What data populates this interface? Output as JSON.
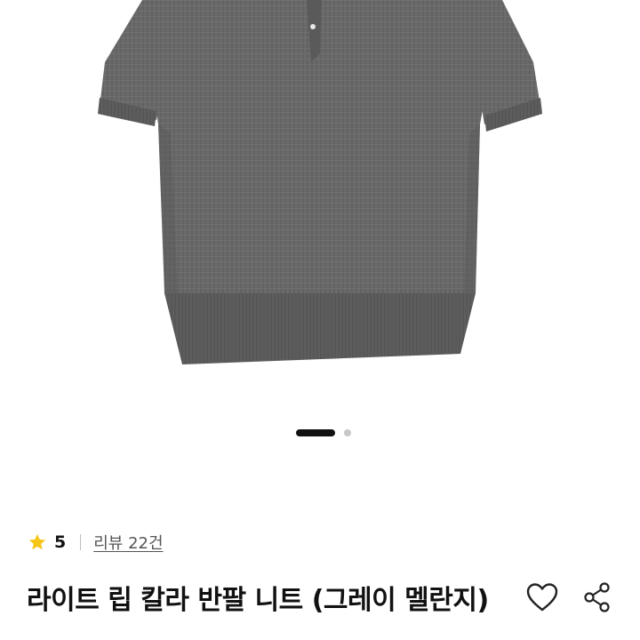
{
  "carousel": {
    "active_index": 1,
    "total": 2
  },
  "rating": {
    "value": "5",
    "review_link": "리뷰 22건"
  },
  "product": {
    "title": "라이트 립 칼라 반팔 니트 (그레이 멜란지)"
  },
  "icons": {
    "rating": "star-icon",
    "wishlist": "heart-icon",
    "share": "share-icon"
  },
  "colors": {
    "star": "#f5c518",
    "knit": "#6b6b6b",
    "active_dot": "#111111",
    "inactive_dot": "#c8c8c8"
  }
}
